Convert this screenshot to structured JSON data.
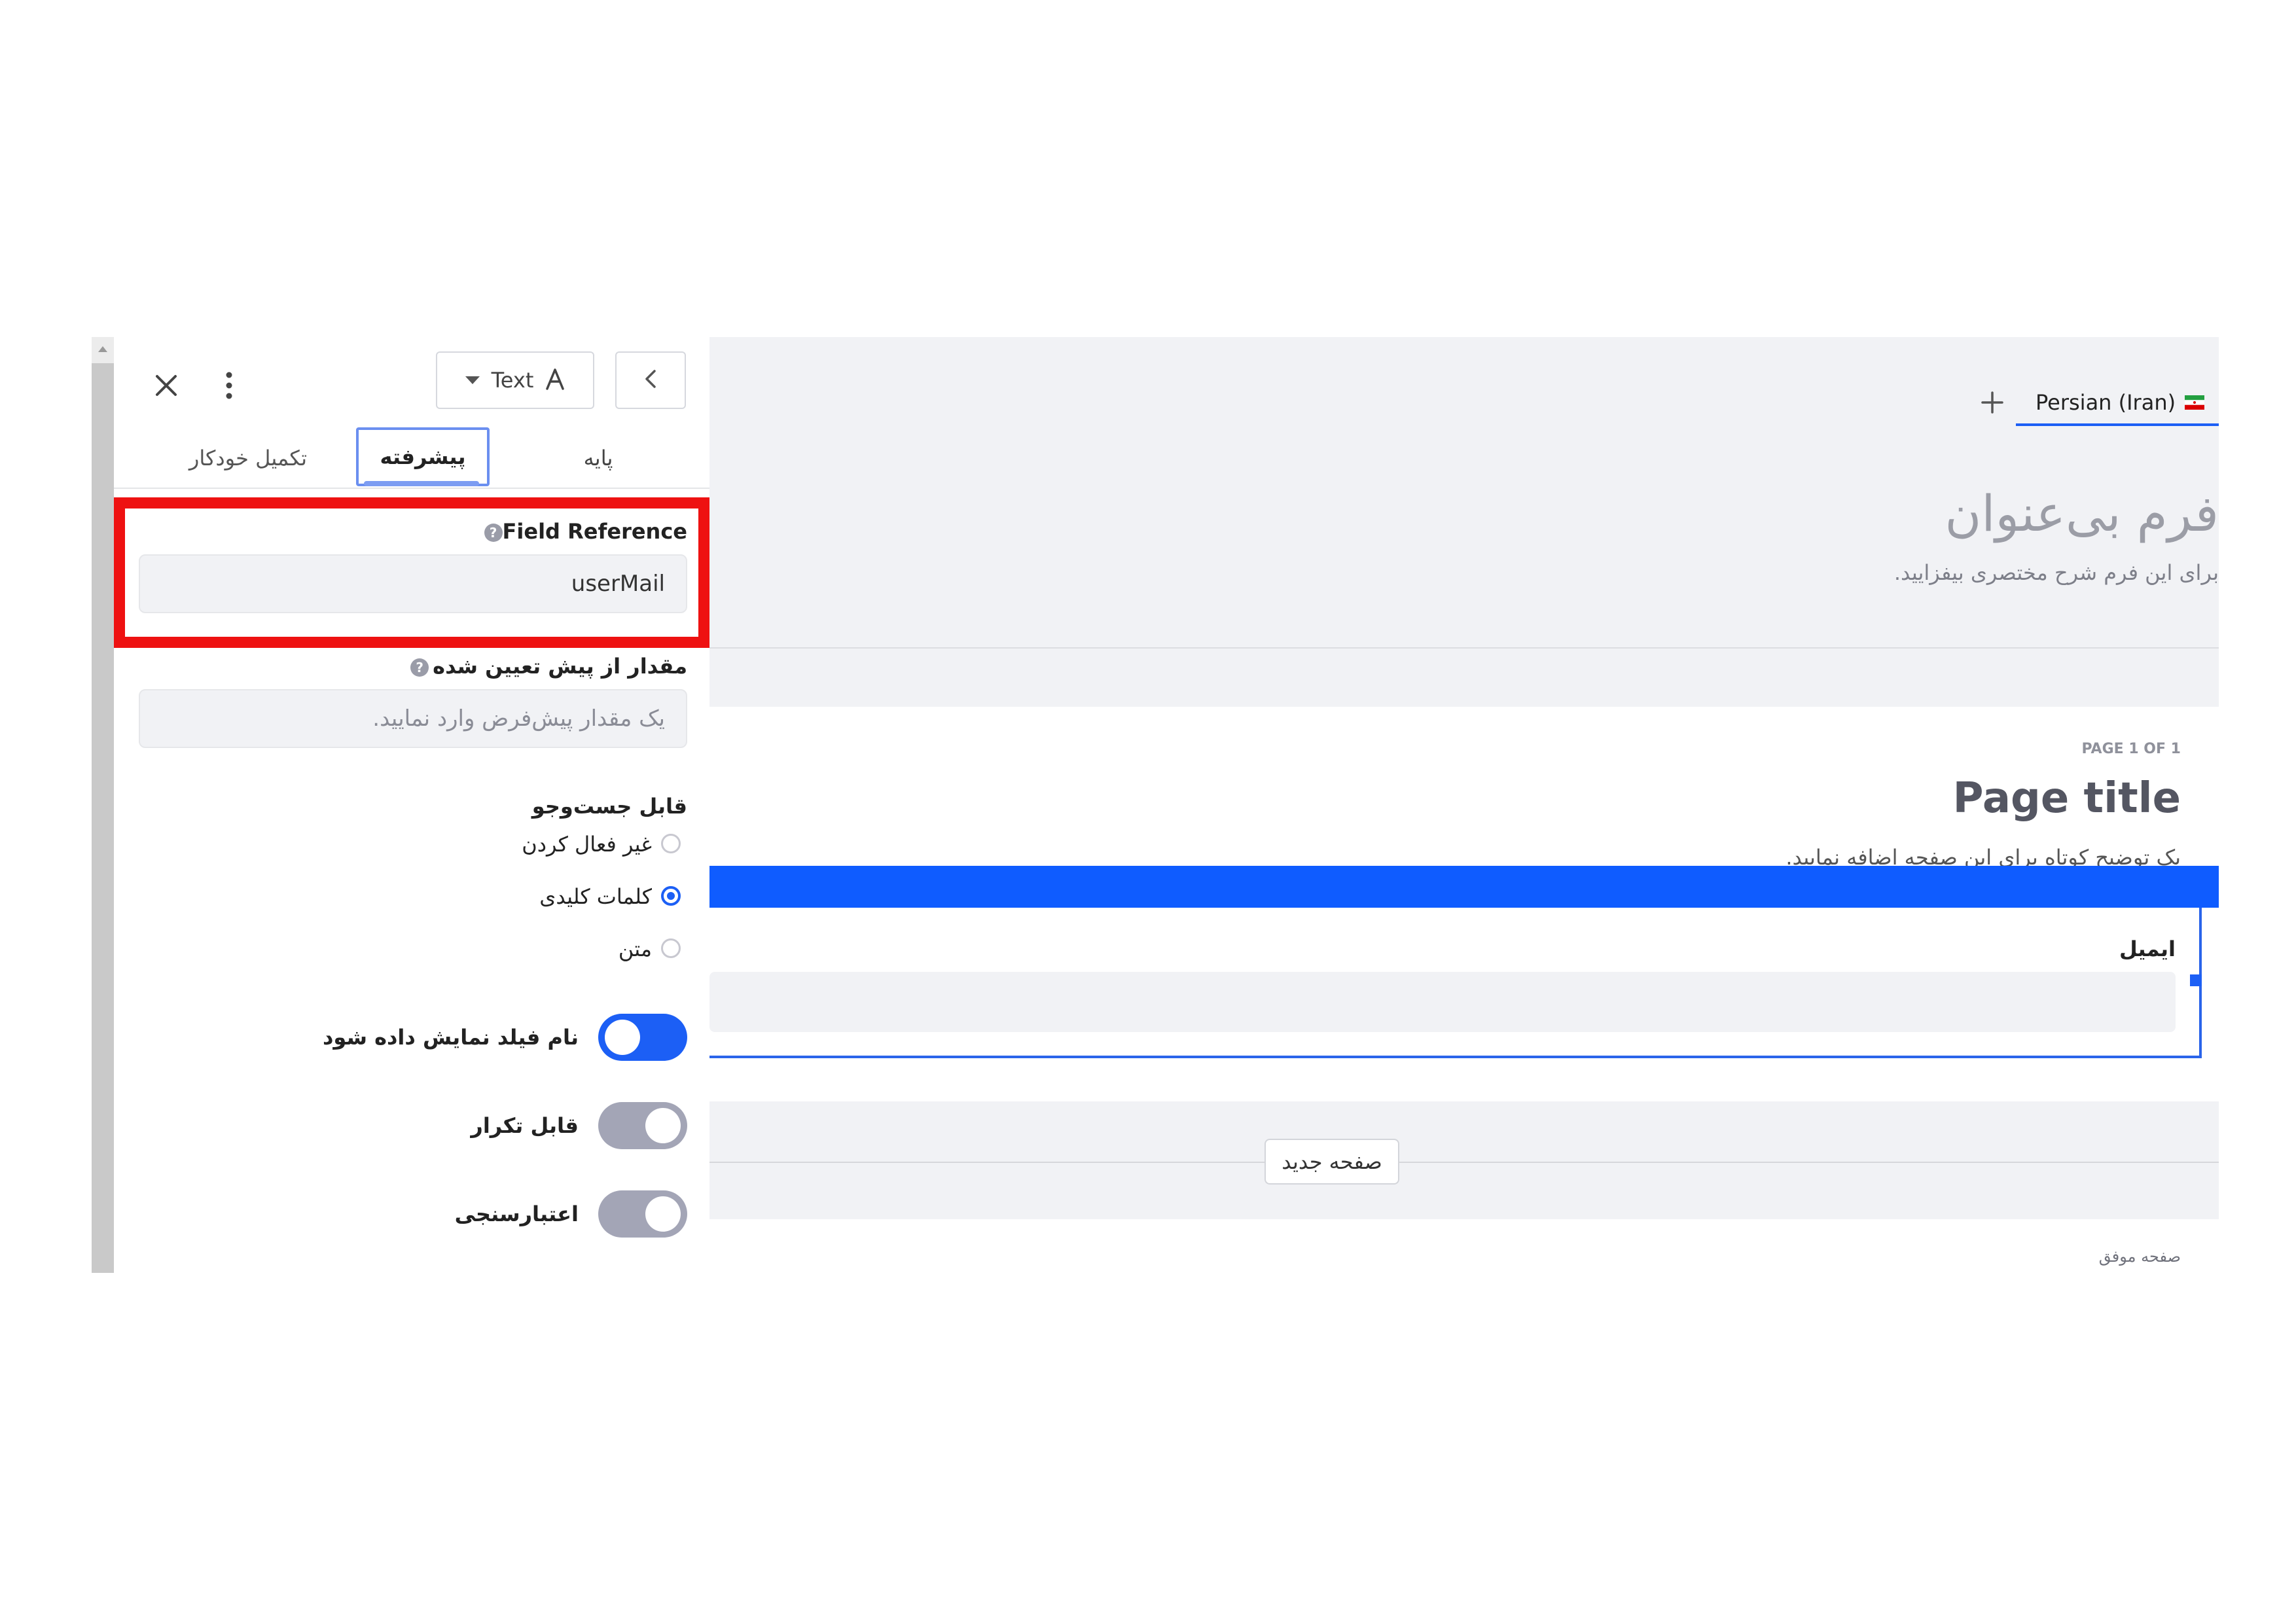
{
  "sidebar": {
    "type_selector_label": "Text",
    "tabs": [
      {
        "label": "پایه"
      },
      {
        "label": "پیشرفته"
      },
      {
        "label": "تکمیل خودکار"
      }
    ],
    "field_reference": {
      "label": "Field Reference",
      "value": "userMail"
    },
    "default_value": {
      "label": "مقدار از پیش تعیین شده",
      "placeholder": "یک مقدار پیش‌فرض وارد نمایید."
    },
    "searchable": {
      "label": "قابل جست‌وجو",
      "options": [
        {
          "label": "غیر فعال کردن",
          "selected": false
        },
        {
          "label": "کلمات کلیدی",
          "selected": true
        },
        {
          "label": "متن",
          "selected": false
        }
      ]
    },
    "toggles": [
      {
        "label": "نام فیلد نمایش داده شود",
        "on": true
      },
      {
        "label": "قابل تکرار",
        "on": false
      },
      {
        "label": "اعتبارسنجی",
        "on": false
      }
    ],
    "highlight_color": "#ee1111"
  },
  "main": {
    "language_tab": "Persian (Iran)",
    "form_title": "فرم بی‌عنوان",
    "form_description": "برای این فرم شرح مختصری بیفزایید.",
    "page_indicator": "PAGE 1 OF 1",
    "page_title": "Page title",
    "page_description": "یک توضیح کوتاه برای این صفحه اضافه نمایید.",
    "email_field_label": "ایمیل",
    "new_page_button": "صفحه جدید",
    "success_page_label": "صفحه موفق",
    "accent_color": "#0f5cff"
  }
}
